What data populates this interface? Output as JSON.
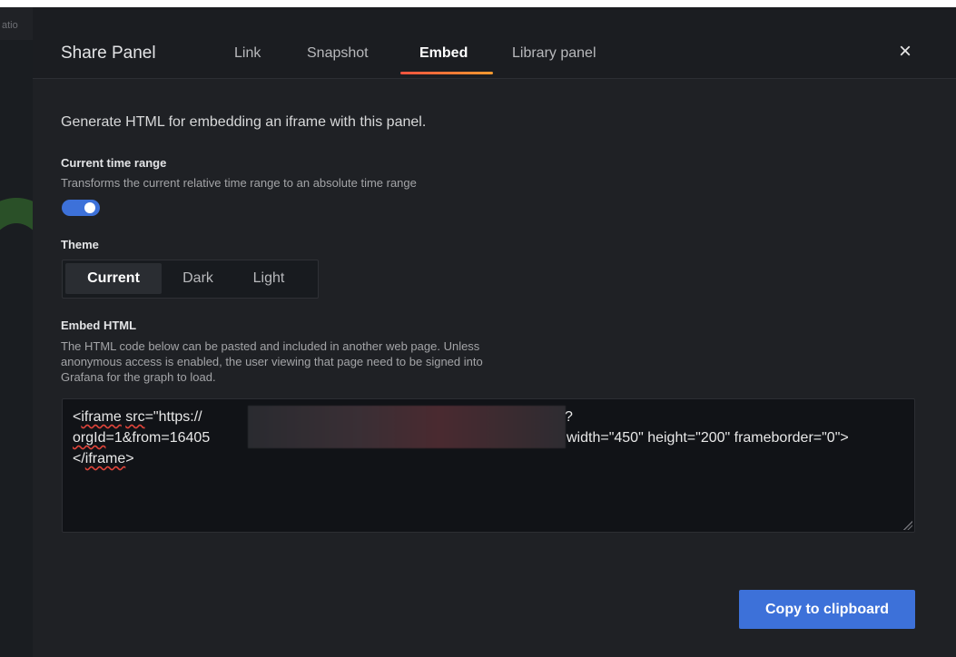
{
  "background": {
    "left_label": "atio"
  },
  "modal": {
    "title": "Share Panel",
    "tabs": [
      {
        "label": "Link",
        "active": false
      },
      {
        "label": "Snapshot",
        "active": false
      },
      {
        "label": "Embed",
        "active": true
      },
      {
        "label": "Library panel",
        "active": false
      }
    ],
    "close_icon": "×"
  },
  "embed": {
    "description": "Generate HTML for embedding an iframe with this panel.",
    "time_range": {
      "label": "Current time range",
      "description": "Transforms the current relative time range to an absolute time range",
      "enabled": true
    },
    "theme": {
      "label": "Theme",
      "options": [
        "Current",
        "Dark",
        "Light"
      ],
      "selected": "Current"
    },
    "embed_html": {
      "label": "Embed HTML",
      "description_lines": [
        "The HTML code below can be pasted and included in another web page. Unless",
        "anonymous access is enabled, the user viewing that page need to be signed into",
        "Grafana for the graph to load."
      ],
      "code_lines": {
        "line1_prefix": "<",
        "line1_tag": "iframe",
        "line1_space": " ",
        "line1_src": "src",
        "line1_rest": "=\"https://",
        "line1_end": "?",
        "line2_orgid": "orgId",
        "line2_rest": "=1&from=16405",
        "line2_end": "width=\"450\" height=\"200\" frameborder=\"0\">",
        "line3_prefix": "</",
        "line3_tag": "iframe",
        "line3_suffix": ">"
      }
    },
    "copy_button": "Copy to clipboard"
  },
  "colors": {
    "accent_blue": "#3d71d9",
    "tab_underline_start": "#f0533f",
    "tab_underline_end": "#f79a2f",
    "modal_bg": "#1f2125"
  }
}
